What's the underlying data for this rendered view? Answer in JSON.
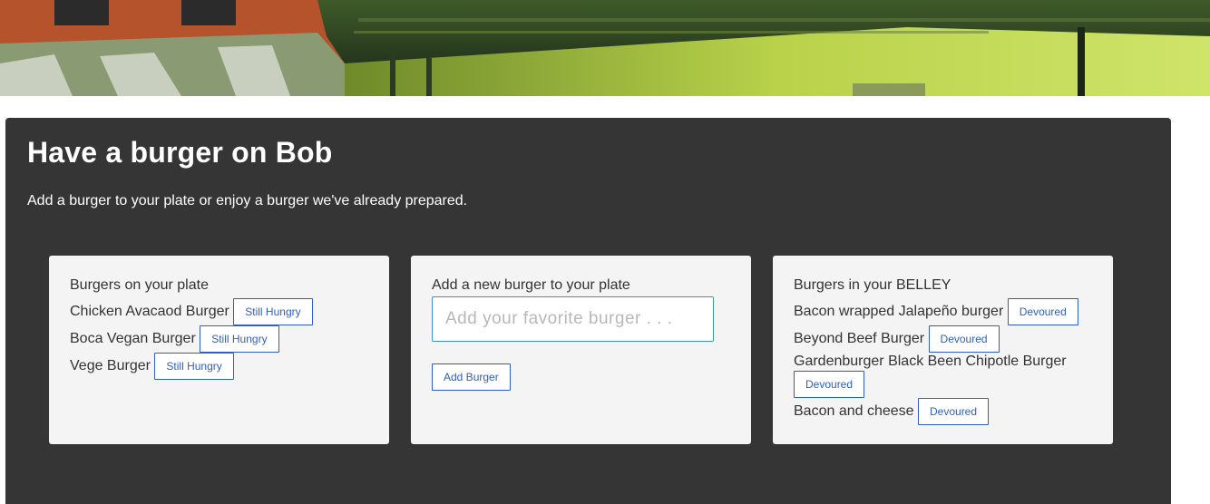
{
  "page": {
    "title": "Have a burger on Bob",
    "subtitle": "Add a burger to your plate or enjoy a burger we've already prepared."
  },
  "plate": {
    "heading": "Burgers on your plate",
    "button_label": "Still Hungry",
    "items": [
      {
        "name": "Chicken Avacaod Burger"
      },
      {
        "name": "Boca Vegan Burger"
      },
      {
        "name": "Vege Burger"
      }
    ]
  },
  "add": {
    "heading": "Add a new burger to your plate",
    "placeholder": "Add your favorite burger . . .",
    "value": "",
    "button_label": "Add Burger"
  },
  "belly": {
    "heading": "Burgers in your BELLEY",
    "button_label": "Devoured",
    "items": [
      {
        "name": "Bacon wrapped Jalapeño burger"
      },
      {
        "name": "Beyond Beef Burger"
      },
      {
        "name": "Gardenburger Black Been Chipotle Burger"
      },
      {
        "name": "Bacon and cheese"
      }
    ]
  },
  "colors": {
    "jumbotron": "#353535",
    "card": "#f4f4f4",
    "button_accent": "#2f5fc0",
    "input_border": "#3f8fc8"
  }
}
